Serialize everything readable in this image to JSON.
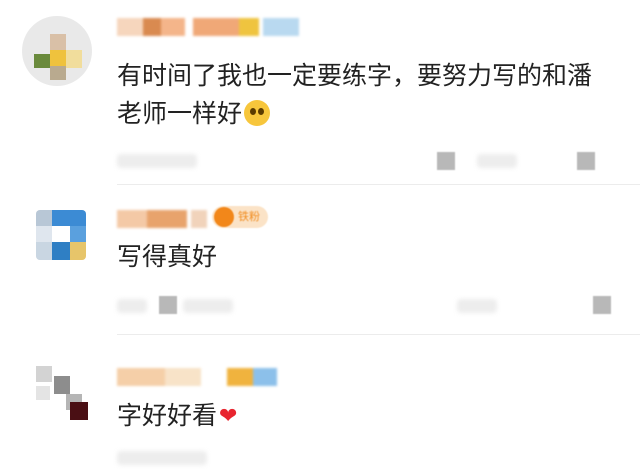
{
  "comments": [
    {
      "text": "有时间了我也一定要练字，要努力写的和潘",
      "text_line2": "老师一样好",
      "emoji_icon": "hugging-face-emoji-icon"
    },
    {
      "badge_label": "铁粉",
      "text": "写得真好"
    },
    {
      "text": "字好好看",
      "emoji_icon": "red-heart-icon",
      "heart_glyph": "❤"
    }
  ],
  "colors": {
    "text": "#222222",
    "badge_orange": "#f2871a",
    "heart": "#e8252f"
  }
}
